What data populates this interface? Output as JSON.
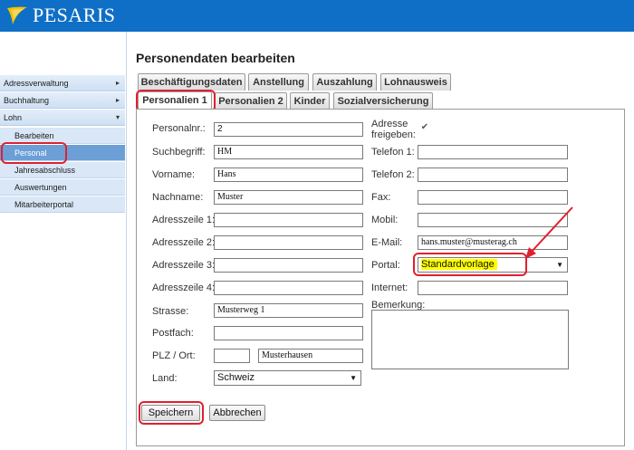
{
  "header": {
    "logo_text": "PESARIS",
    "logo_icon": "pesaris-swoosh-icon"
  },
  "sidebar": {
    "items": [
      {
        "label": "Adressverwaltung",
        "arrow": "▸"
      },
      {
        "label": "Buchhaltung",
        "arrow": "▸"
      },
      {
        "label": "Lohn",
        "arrow": "▾"
      }
    ],
    "subitems": [
      {
        "label": "Bearbeiten"
      },
      {
        "label": "Personal"
      },
      {
        "label": "Jahresabschluss"
      },
      {
        "label": "Auswertungen"
      },
      {
        "label": "Mitarbeiterportal"
      }
    ]
  },
  "main": {
    "title": "Personendaten bearbeiten",
    "tabs_row1": [
      "Beschäftigungsdaten",
      "Anstellung",
      "Auszahlung",
      "Lohnausweis"
    ],
    "tabs_row2": [
      "Personalien 1",
      "Personalien 2",
      "Kinder",
      "Sozialversicherung"
    ],
    "active_tab": "Personalien 1"
  },
  "form": {
    "left": [
      {
        "label": "Personalnr.:",
        "value": "2"
      },
      {
        "label": "Suchbegriff:",
        "value": "HM"
      },
      {
        "label": "Vorname:",
        "value": "Hans"
      },
      {
        "label": "Nachname:",
        "value": "Muster"
      },
      {
        "label": "Adresszeile 1:",
        "value": ""
      },
      {
        "label": "Adresszeile 2:",
        "value": ""
      },
      {
        "label": "Adresszeile 3:",
        "value": ""
      },
      {
        "label": "Adresszeile 4:",
        "value": ""
      },
      {
        "label": "Strasse:",
        "value": "Musterweg 1"
      },
      {
        "label": "Postfach:",
        "value": ""
      },
      {
        "label": "PLZ / Ort:",
        "plz": "",
        "ort": "Musterhausen"
      },
      {
        "label": "Land:",
        "value": "Schweiz"
      }
    ],
    "right": {
      "adresse_freigeben_line1": "Adresse",
      "adresse_freigeben_line2": "freigeben:",
      "adresse_freigeben_checked": true,
      "telefon1_label": "Telefon 1:",
      "telefon1": "",
      "telefon2_label": "Telefon 2:",
      "telefon2": "",
      "fax_label": "Fax:",
      "fax": "",
      "mobil_label": "Mobil:",
      "mobil": "",
      "email_label": "E-Mail:",
      "email": "hans.muster@musterag.ch",
      "portal_label": "Portal:",
      "portal": "Standardvorlage",
      "internet_label": "Internet:",
      "internet": "",
      "bemerkung_label": "Bemerkung:",
      "bemerkung": ""
    },
    "buttons": {
      "save": "Speichern",
      "cancel": "Abbrechen"
    }
  },
  "colors": {
    "header_blue": "#0f6fc6",
    "highlight_red": "#e0202e",
    "portal_highlight": "#ffff00",
    "sidebar_active": "#6b9fd6"
  }
}
